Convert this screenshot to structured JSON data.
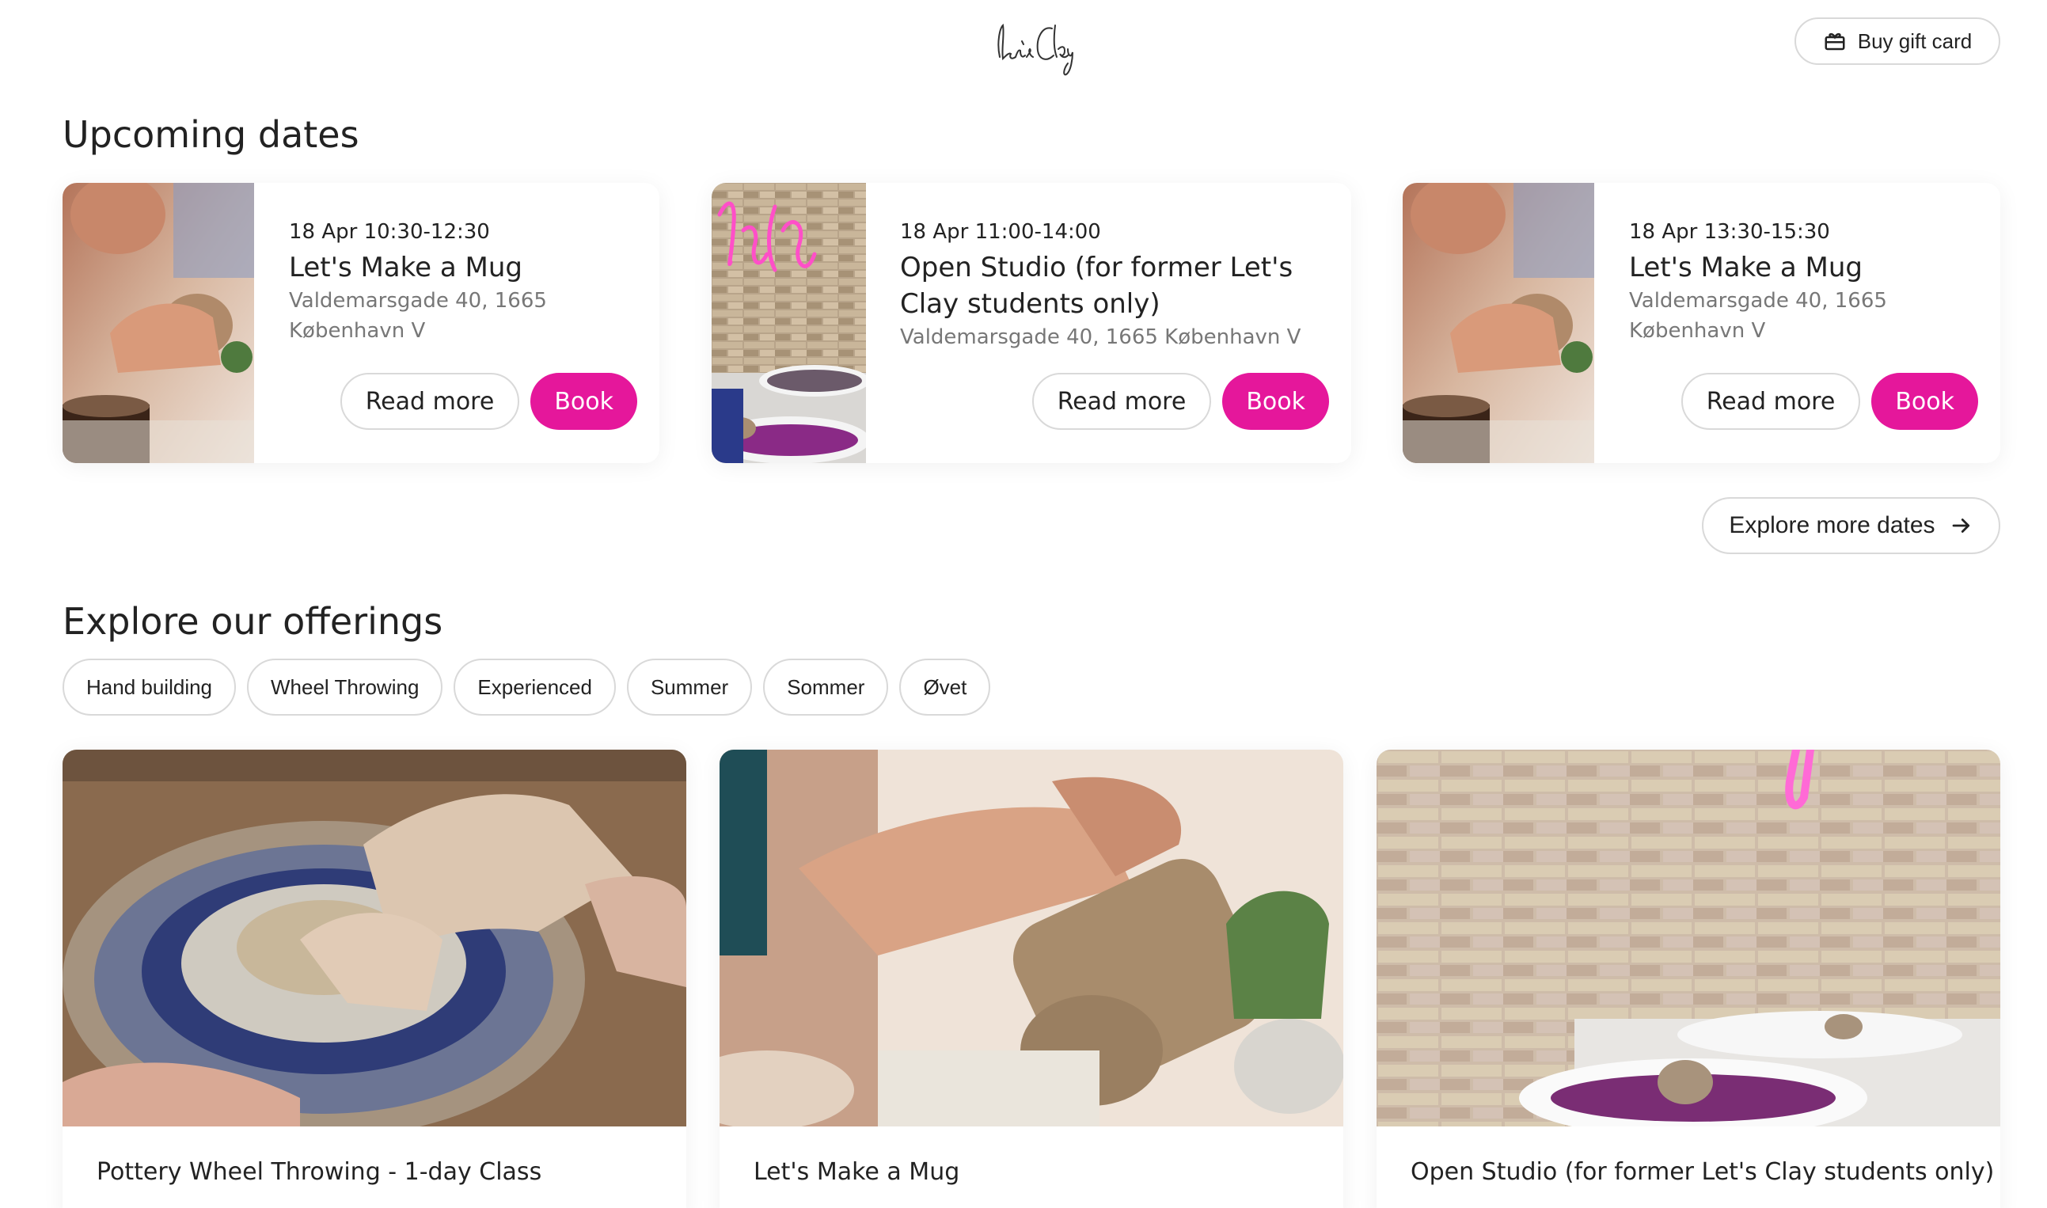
{
  "header": {
    "logo_text": "let's Clay",
    "gift_button_label": "Buy gift card"
  },
  "upcoming": {
    "title": "Upcoming dates",
    "cards": [
      {
        "time": "18 Apr 10:30-12:30",
        "title": "Let's Make a Mug",
        "address": "Valdemarsgade 40, 1665 København V",
        "read_more_label": "Read more",
        "book_label": "Book"
      },
      {
        "time": "18 Apr 11:00-14:00",
        "title": "Open Studio (for former Let's Clay students only)",
        "address": "Valdemarsgade 40, 1665 København V",
        "read_more_label": "Read more",
        "book_label": "Book"
      },
      {
        "time": "18 Apr 13:30-15:30",
        "title": "Let's Make a Mug",
        "address": "Valdemarsgade 40, 1665 København V",
        "read_more_label": "Read more",
        "book_label": "Book"
      }
    ],
    "explore_more_label": "Explore more dates"
  },
  "offerings": {
    "title": "Explore our offerings",
    "filters": [
      "Hand building",
      "Wheel Throwing",
      "Experienced",
      "Summer",
      "Sommer",
      "Øvet"
    ],
    "cards": [
      {
        "title": "Pottery Wheel Throwing - 1-day Class"
      },
      {
        "title": "Let's Make a Mug"
      },
      {
        "title": "Open Studio (for former Let's Clay students only)"
      }
    ]
  },
  "colors": {
    "accent": "#e5179b",
    "border": "#d9d9d9",
    "text": "#222222",
    "muted": "#777777"
  }
}
